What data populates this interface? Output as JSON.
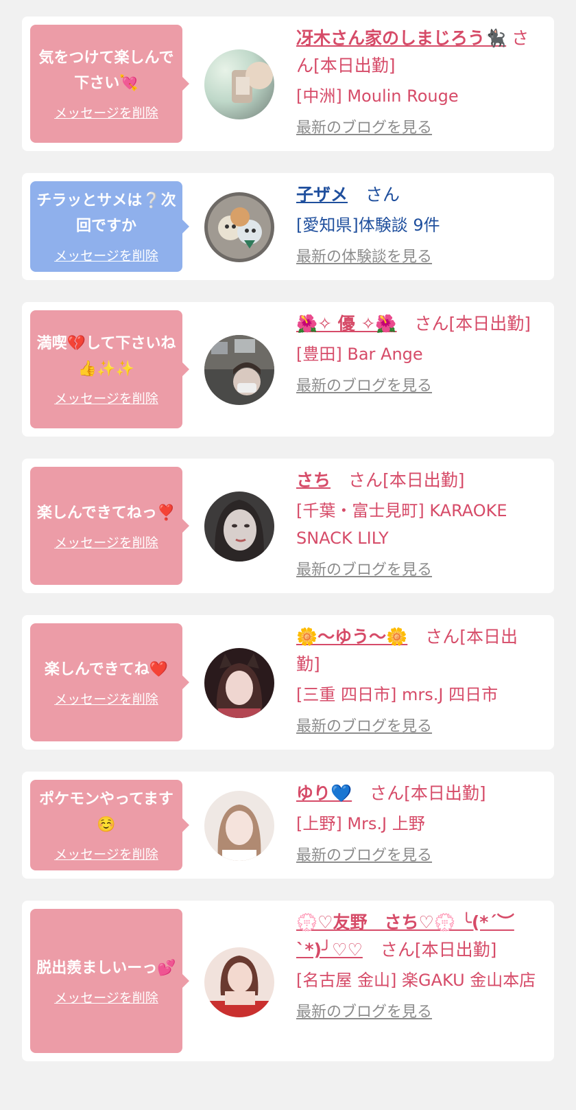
{
  "cards": [
    {
      "bubble_color": "pink",
      "message": "気をつけて楽しんで下さい💘",
      "delete_label": "メッセージを削除",
      "name": "冴木さん家のしまじろう🐈‍⬛",
      "suffix": "さん[本日出勤]",
      "shop": "[中洲] Moulin Rouge",
      "blog_label": "最新のブログを見る"
    },
    {
      "bubble_color": "blue",
      "message": "チラッとサメは❔次回ですか",
      "delete_label": "メッセージを削除",
      "name": "子ザメ",
      "suffix": "さん",
      "shop": "[愛知県]体験談 9件",
      "blog_label": "最新の体験談を見る"
    },
    {
      "bubble_color": "pink",
      "message": "満喫💔して下さいね👍✨✨",
      "delete_label": "メッセージを削除",
      "name": "🌺✧ 優 ✧🌺",
      "suffix": "さん[本日出勤]",
      "shop": "[豊田] Bar Ange",
      "blog_label": "最新のブログを見る"
    },
    {
      "bubble_color": "pink",
      "message": "楽しんできてねっ❣️",
      "delete_label": "メッセージを削除",
      "name": "さち",
      "suffix": "さん[本日出勤]",
      "shop": "[千葉・富士見町] KARAOKE SNACK LILY",
      "blog_label": "最新のブログを見る"
    },
    {
      "bubble_color": "pink",
      "message": "楽しんできてね❤️",
      "delete_label": "メッセージを削除",
      "name": "🌼〜ゆう〜🌼",
      "suffix": "さん[本日出勤]",
      "shop": "[三重 四日市] mrs.J 四日市",
      "blog_label": "最新のブログを見る"
    },
    {
      "bubble_color": "pink",
      "message": "ポケモンやってます☺️",
      "delete_label": "メッセージを削除",
      "name": "ゆり💙",
      "suffix": "さん[本日出勤]",
      "shop": "[上野] Mrs.J 上野",
      "blog_label": "最新のブログを見る"
    },
    {
      "bubble_color": "pink",
      "message": "脱出羨ましいーっ💕",
      "delete_label": "メッセージを削除",
      "name": "💮♡友野　さち♡💮 ╰(*´︶`*)╯♡♡",
      "suffix": "さん[本日出勤]",
      "shop": "[名古屋 金山] 楽GAKU 金山本店",
      "blog_label": "最新のブログを見る"
    }
  ],
  "colors": {
    "background": "#f1f1f1",
    "card": "#ffffff",
    "bubble_pink": "#ec9ca7",
    "bubble_blue": "#8fb0ec",
    "text_pink": "#d64b68",
    "text_blue": "#1f4f9d",
    "link_gray": "#8c8c8c"
  }
}
